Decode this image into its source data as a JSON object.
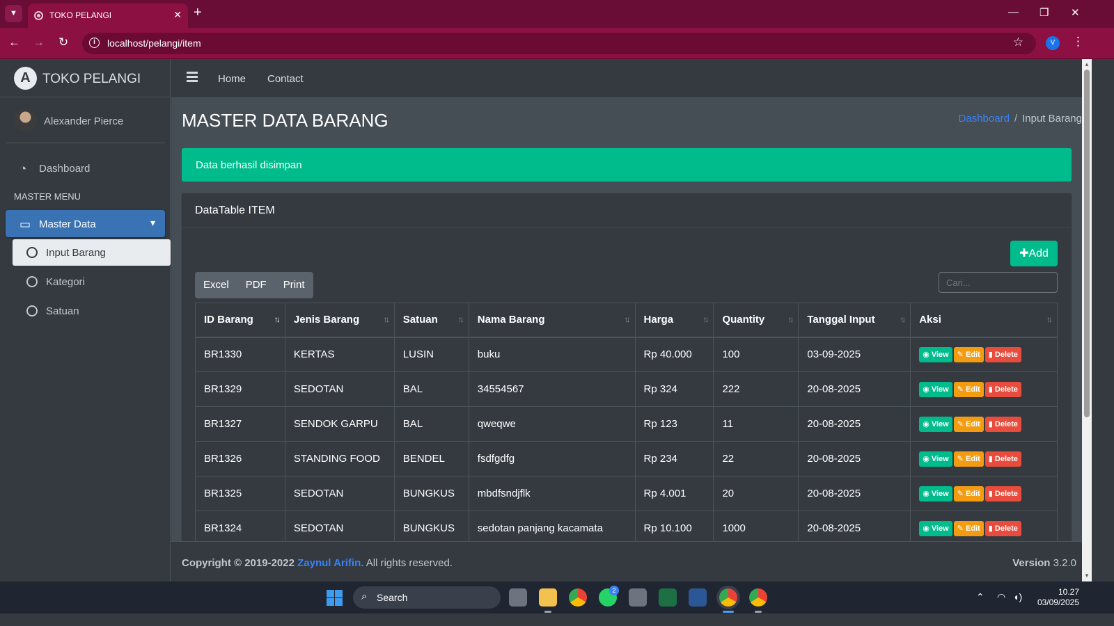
{
  "browser": {
    "tab_title": "TOKO PELANGI",
    "url": "localhost/pelangi/item",
    "profile_initial": "V"
  },
  "sidebar": {
    "brand": "TOKO PELANGI",
    "user": "Alexander Pierce",
    "dashboard": "Dashboard",
    "header": "MASTER MENU",
    "master_data": "Master Data",
    "sub_items": [
      "Input Barang",
      "Kategori",
      "Satuan"
    ]
  },
  "topnav": {
    "home": "Home",
    "contact": "Contact"
  },
  "page": {
    "title": "MASTER DATA BARANG",
    "breadcrumb_link": "Dashboard",
    "breadcrumb_current": "Input Barang",
    "alert": "Data berhasil disimpan"
  },
  "card": {
    "title": "DataTable ITEM",
    "add_label": "Add",
    "buttons": [
      "Excel",
      "PDF",
      "Print"
    ],
    "search_placeholder": "Cari..."
  },
  "table": {
    "columns": [
      "ID Barang",
      "Jenis Barang",
      "Satuan",
      "Nama Barang",
      "Harga",
      "Quantity",
      "Tanggal Input",
      "Aksi"
    ],
    "rows": [
      [
        "BR1330",
        "KERTAS",
        "LUSIN",
        "buku",
        "Rp 40.000",
        "100",
        "03-09-2025"
      ],
      [
        "BR1329",
        "SEDOTAN",
        "BAL",
        "34554567",
        "Rp 324",
        "222",
        "20-08-2025"
      ],
      [
        "BR1327",
        "SENDOK GARPU",
        "BAL",
        "qweqwe",
        "Rp 123",
        "11",
        "20-08-2025"
      ],
      [
        "BR1326",
        "STANDING FOOD",
        "BENDEL",
        "fsdfgdfg",
        "Rp 234",
        "22",
        "20-08-2025"
      ],
      [
        "BR1325",
        "SEDOTAN",
        "BUNGKUS",
        "mbdfsndjflk",
        "Rp 4.001",
        "20",
        "20-08-2025"
      ],
      [
        "BR1324",
        "SEDOTAN",
        "BUNGKUS",
        "sedotan panjang kacamata",
        "Rp 10.100",
        "1000",
        "20-08-2025"
      ]
    ],
    "actions": {
      "view": "View",
      "edit": "Edit",
      "delete": "Delete"
    }
  },
  "footer": {
    "copyright": "Copyright © 2019-2022",
    "author": "Zaynul Arifin.",
    "rights": "All rights reserved.",
    "version_label": "Version",
    "version": "3.2.0"
  },
  "taskbar": {
    "search": "Search",
    "whatsapp_badge": "2",
    "time": "10.27",
    "date": "03/09/2025"
  },
  "colors": {
    "accent_green": "#00bc8c",
    "accent_blue": "#3a73b4",
    "warning": "#f39c12",
    "danger": "#e74c3c",
    "browser_frame": "#8d1042"
  },
  "icons": [
    "chevron-down-icon",
    "close-icon",
    "plus-icon",
    "back-icon",
    "forward-icon",
    "reload-icon",
    "info-icon",
    "star-icon",
    "kebab-icon",
    "dashboard-icon",
    "store-icon",
    "circle-icon",
    "hamburger-icon",
    "eye-icon",
    "edit-icon",
    "trash-icon",
    "sort-icon",
    "search-icon",
    "wifi-icon",
    "volume-icon"
  ]
}
